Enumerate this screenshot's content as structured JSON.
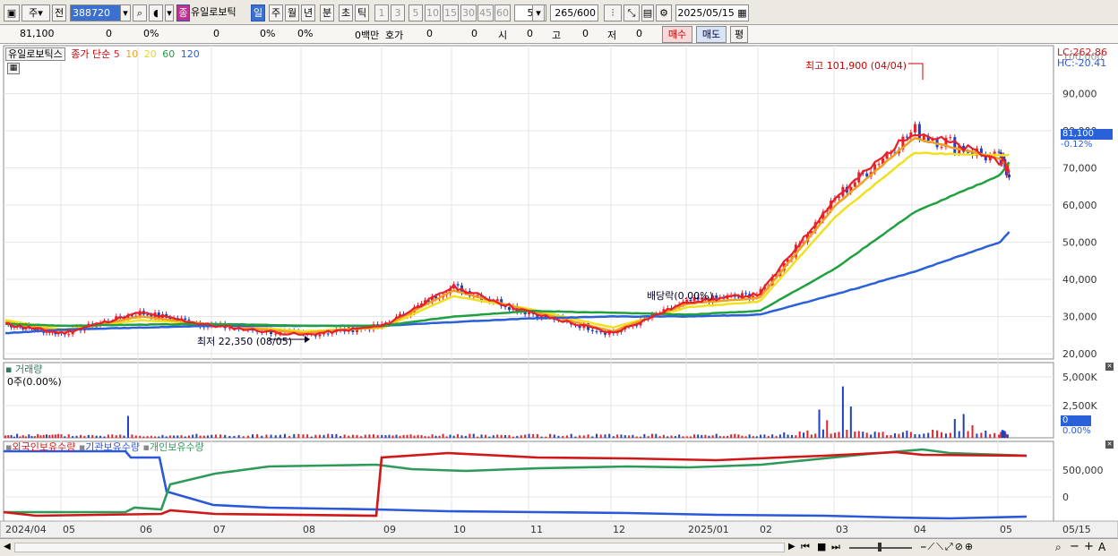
{
  "toolbar": {
    "type_label": "주",
    "prefix_label": "전",
    "code_value": "388720",
    "stock_name": "유일로보틱",
    "periods": [
      "일",
      "주",
      "월",
      "년",
      "분",
      "초",
      "틱"
    ],
    "active_period": "일",
    "intervals": [
      "1",
      "3",
      "5",
      "10",
      "15",
      "30",
      "45",
      "60"
    ],
    "interval_value": "5",
    "count_value": "265",
    "count_max": "/600",
    "date_value": "2025/05/15"
  },
  "infobar": {
    "price": "81,100",
    "change": "0",
    "change_pct": "0%",
    "volume": "0",
    "vol_pct": "0%",
    "vol_pct2": "0%",
    "amount": "0백만",
    "quote_label": "호가",
    "quote_val1": "0",
    "quote_val2": "0",
    "open_label": "시",
    "open_val": "0",
    "high_label": "고",
    "high_val": "0",
    "low_label": "저",
    "low_val": "0",
    "buy_label": "매수",
    "sell_label": "매도",
    "avg_label": "평"
  },
  "price_panel": {
    "stock_tag": "유일로보틱스",
    "ma_title": "종가 단순",
    "ma_periods": [
      "5",
      "10",
      "20",
      "60",
      "120"
    ],
    "lc_label": "LC:262.86",
    "hc_label": "HC:-20.41",
    "high_annot": "최고 101,900 (04/04)",
    "low_annot": "최저 22,350 (08/05)",
    "dividend_annot": "배당락(0.00%)",
    "current_price_tag": "81,100",
    "current_pct_tag": "-0.12%",
    "y_ticks": [
      "90,000",
      "80,000",
      "70,000",
      "60,000",
      "50,000",
      "40,000",
      "30,000",
      "20,000"
    ],
    "y_top_partial": "100,000"
  },
  "volume_panel": {
    "title": "거래량",
    "value_label": "0주(0.00%)",
    "y_ticks": [
      "5,000K",
      "2,500K"
    ],
    "current_tag": "0",
    "pct_tag": "0.00%"
  },
  "holding_panel": {
    "series_labels": [
      "외국인보유수량",
      "기관보유수량",
      "개인보유수량"
    ],
    "y_ticks": [
      "500,000",
      "0"
    ]
  },
  "x_axis": {
    "labels": [
      "2024/04",
      "05",
      "06",
      "07",
      "08",
      "09",
      "10",
      "11",
      "12",
      "2025/01",
      "02",
      "03",
      "04",
      "05",
      "05/15"
    ]
  },
  "colors": {
    "ma5": "#e8202a",
    "ma10": "#f0a020",
    "ma20": "#f0e020",
    "ma60": "#20a040",
    "ma120": "#2a60d8",
    "up": "#e8202a",
    "down": "#2040c0",
    "foreign": "#d01818",
    "institution": "#2a58d8",
    "individual": "#2e9a5a"
  },
  "chart_data": {
    "type": "line",
    "title": "",
    "x": [
      "2024/04",
      "05",
      "06",
      "07",
      "08",
      "09",
      "10",
      "11",
      "12",
      "2025/01",
      "02",
      "03",
      "04",
      "05"
    ],
    "series": [
      {
        "name": "5",
        "values": [
          28000,
          25500,
          31000,
          27500,
          25000,
          27500,
          38000,
          31000,
          25500,
          34000,
          36000,
          62000,
          80000,
          72000
        ]
      },
      {
        "name": "10",
        "values": [
          28500,
          25800,
          30000,
          27800,
          25500,
          27300,
          37000,
          31500,
          26000,
          33500,
          35000,
          60000,
          78000,
          72500
        ]
      },
      {
        "name": "20",
        "values": [
          29000,
          26500,
          29000,
          28000,
          26000,
          27000,
          35500,
          32000,
          27000,
          32500,
          34000,
          57000,
          74000,
          73500
        ]
      },
      {
        "name": "60",
        "values": [
          28000,
          27500,
          27800,
          28000,
          27500,
          27500,
          30000,
          31500,
          31000,
          30500,
          31500,
          43000,
          58000,
          68000
        ]
      },
      {
        "name": "120",
        "values": [
          25500,
          26500,
          27000,
          27500,
          27500,
          27500,
          28500,
          29500,
          30000,
          30000,
          30500,
          36000,
          42000,
          50000
        ]
      }
    ],
    "ylim": [
      20000,
      100000
    ],
    "xlabel": "",
    "ylabel": ""
  }
}
